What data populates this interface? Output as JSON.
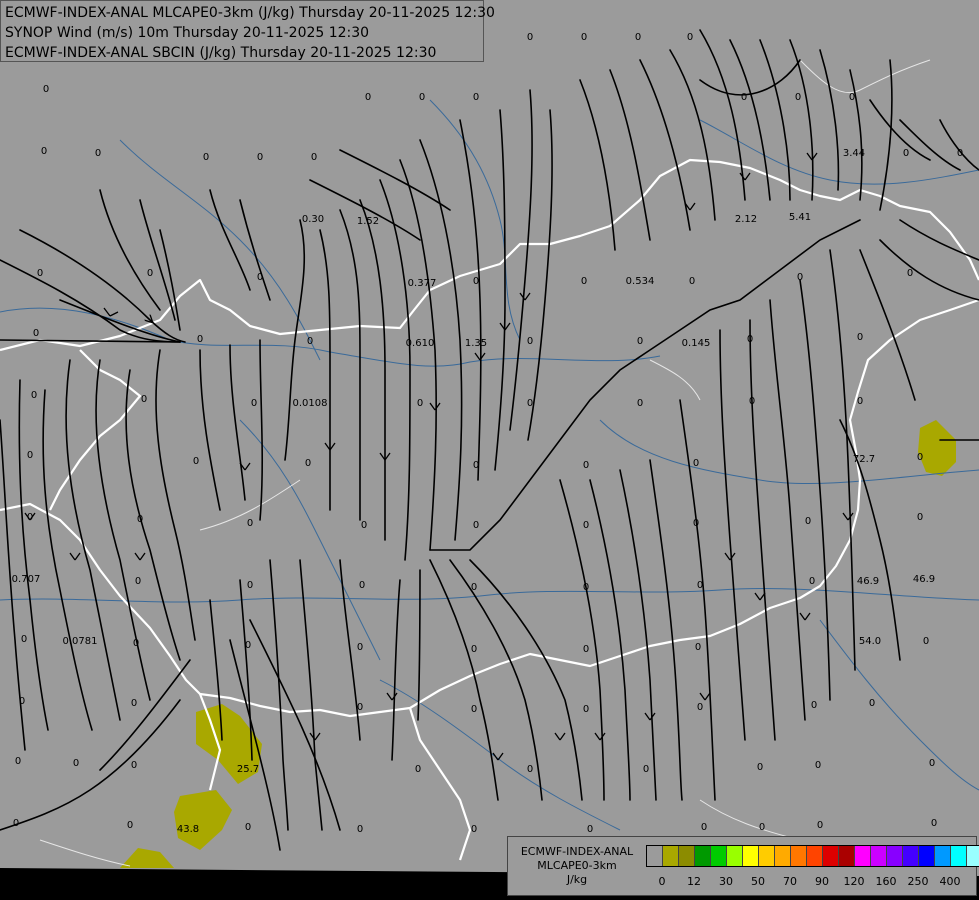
{
  "header": {
    "line1": "ECMWF-INDEX-ANAL MLCAPE0-3km (J/kg) Thursday 20-11-2025 12:30",
    "line2": "SYNOP Wind (m/s) 10m Thursday 20-11-2025 12:30",
    "line3": "ECMWF-INDEX-ANAL SBCIN (J/kg) Thursday 20-11-2025 12:30"
  },
  "legend": {
    "title_line1": "ECMWF-INDEX-ANAL",
    "title_line2": "MLCAPE0-3km",
    "title_line3": "J/kg",
    "colors": [
      "#9b9b9b",
      "#a9a800",
      "#8c8c00",
      "#009900",
      "#00cc00",
      "#99ff00",
      "#ffff00",
      "#ffcc00",
      "#ffaa00",
      "#ff7700",
      "#ff4400",
      "#dd0000",
      "#aa0000",
      "#ff00ff",
      "#cc00ff",
      "#8800ff",
      "#4400ff",
      "#0000ff",
      "#0099ff",
      "#00ffff",
      "#99ffff",
      "#ffffff"
    ],
    "tick_labels": [
      "0",
      "12",
      "30",
      "50",
      "70",
      "90",
      "120",
      "160",
      "250",
      "400"
    ]
  },
  "colors": {
    "background": "#9b9b9b",
    "cape_shade": "#a9a800",
    "borders": "#ffffff",
    "rivers": "#3a6a9a",
    "streamlines": "#000000"
  },
  "map_values": {
    "cin_labels": [
      "0.30",
      "1.52",
      "0.377",
      "0.534",
      "2.12",
      "5.41",
      "3.44",
      "0.610",
      "1.35",
      "0.145",
      "0.0108",
      "0.707",
      "0.0781",
      "72.7",
      "46.9",
      "46.9",
      "54.0",
      "25.7",
      "43.8"
    ],
    "zero_label": "0"
  }
}
